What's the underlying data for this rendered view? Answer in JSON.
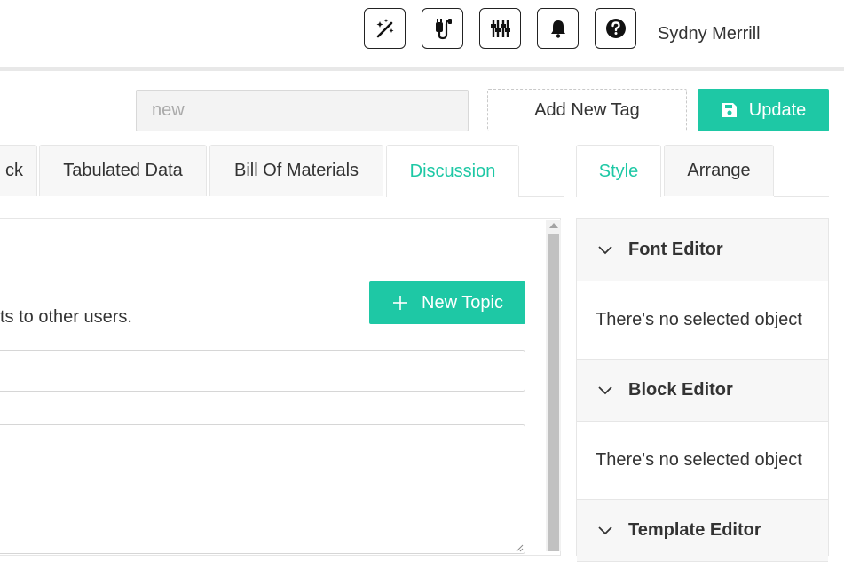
{
  "header": {
    "user_name": "Sydny Merrill",
    "icons": [
      "magic-wand-icon",
      "plug-icon",
      "sliders-icon",
      "bell-icon",
      "help-icon"
    ]
  },
  "toolbar": {
    "search_value": "new",
    "add_tag_label": "Add New Tag",
    "update_label": "Update"
  },
  "main_tabs": [
    {
      "label": "ck",
      "active": false
    },
    {
      "label": "Tabulated Data",
      "active": false
    },
    {
      "label": "Bill Of Materials",
      "active": false
    },
    {
      "label": "Discussion",
      "active": true
    }
  ],
  "side_tabs": [
    {
      "label": "Style",
      "active": true
    },
    {
      "label": "Arrange",
      "active": false
    }
  ],
  "discussion": {
    "hint_text": "ts to other users.",
    "new_topic_label": "New Topic"
  },
  "side_sections": [
    {
      "title": "Font Editor",
      "body": "There's no selected object"
    },
    {
      "title": "Block Editor",
      "body": "There's no selected object"
    },
    {
      "title": "Template Editor"
    }
  ],
  "colors": {
    "accent": "#1ec8a5"
  }
}
